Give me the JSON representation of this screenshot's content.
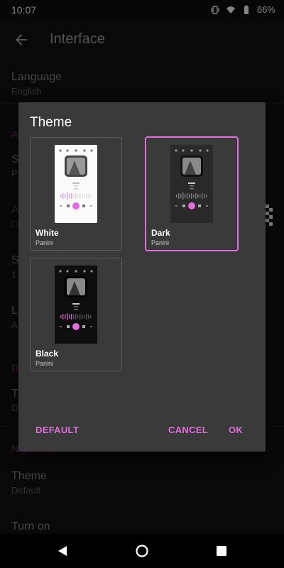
{
  "status": {
    "time": "10:07",
    "battery": "66%"
  },
  "appbar": {
    "title": "Interface"
  },
  "background": {
    "language_title": "Language",
    "language_value": "English",
    "section_a": "A",
    "row_s": "S",
    "row_p": "P",
    "row_a": "A",
    "row_d": "D",
    "row_s2": "S",
    "row_1": "1",
    "row_l": "L",
    "row_a2": "A",
    "section_d": "D",
    "row_t": "T",
    "row_d2": "D",
    "night_mode": "Night Mode",
    "theme_title": "Theme",
    "theme_value": "Default",
    "turn_on": "Turn on"
  },
  "dialog": {
    "title": "Theme",
    "options": [
      {
        "name": "White",
        "author": "Panini",
        "preview_label": "Title",
        "selected": false
      },
      {
        "name": "Dark",
        "author": "Panini",
        "preview_label": "Title",
        "selected": true
      },
      {
        "name": "Black",
        "author": "Panini",
        "preview_label": "Title",
        "selected": false
      }
    ],
    "buttons": {
      "default": "DEFAULT",
      "cancel": "CANCEL",
      "ok": "OK"
    }
  },
  "colors": {
    "accent": "#e56be0",
    "dialog_bg": "#3a3a3a",
    "background": "#121212"
  },
  "icons": [
    "vibrate-icon",
    "wifi-icon",
    "battery-icon",
    "back-arrow-icon",
    "nav-back-icon",
    "nav-home-icon",
    "nav-recents-icon"
  ]
}
